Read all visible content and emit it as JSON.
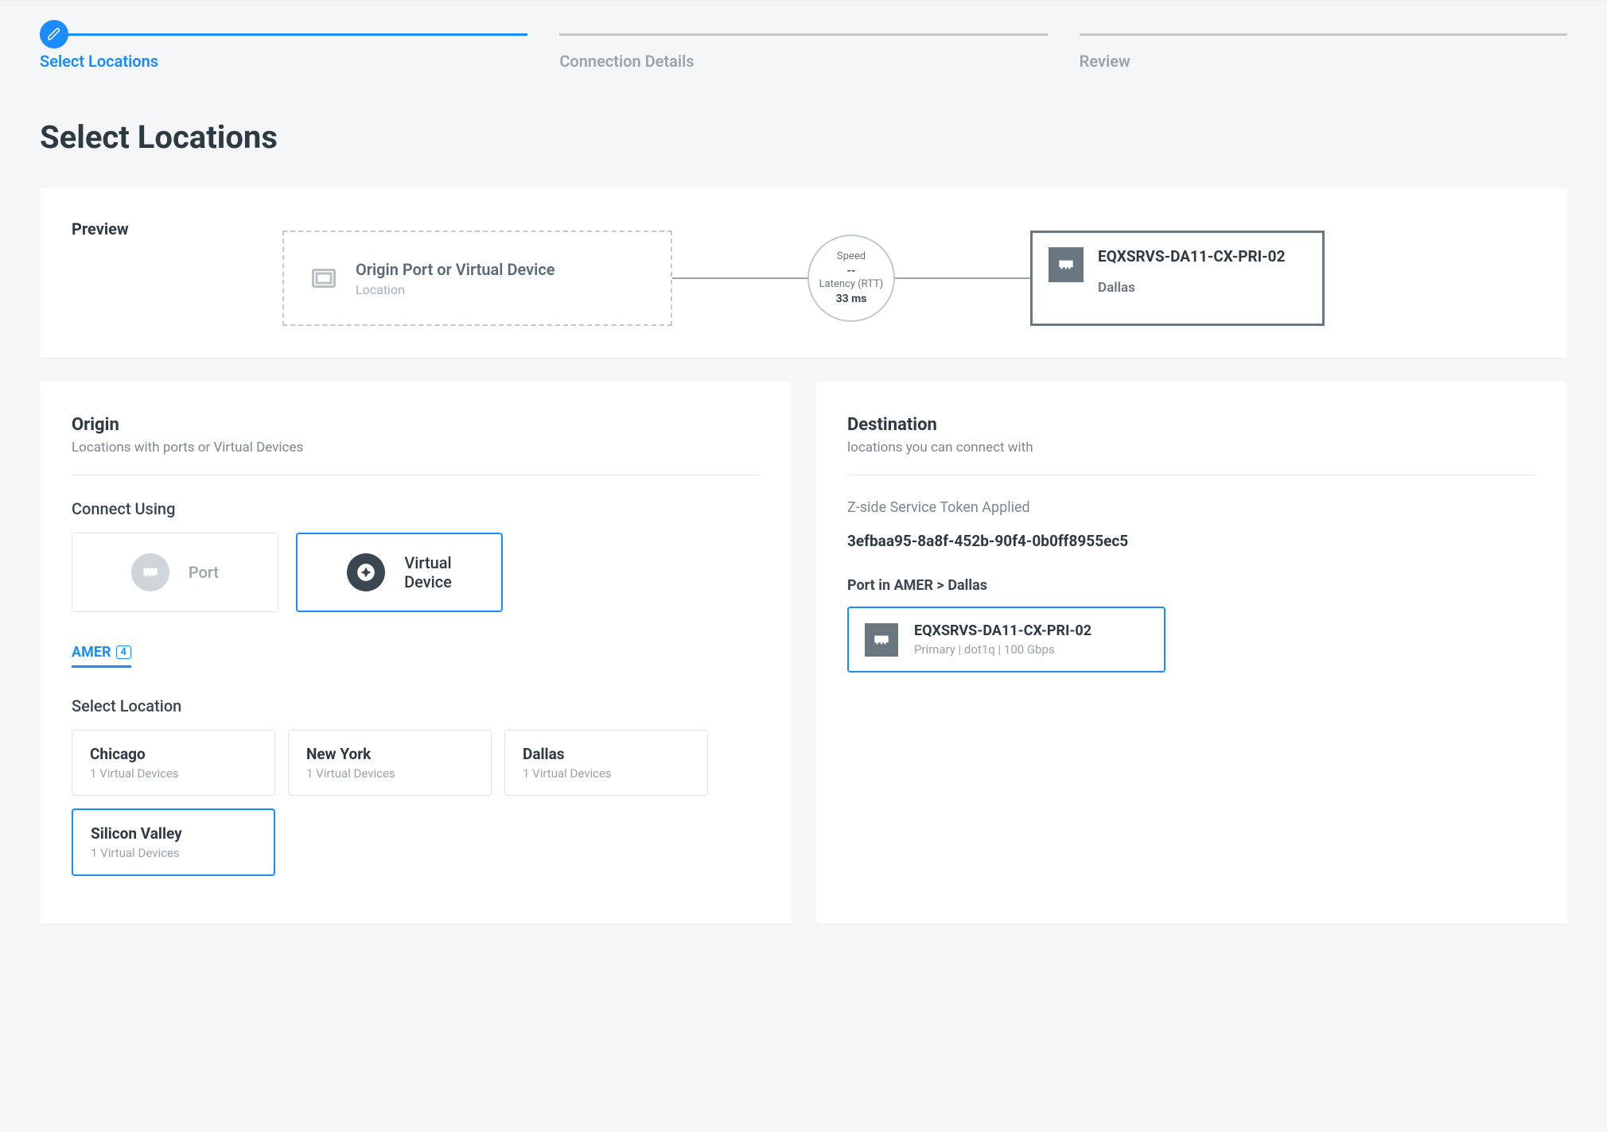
{
  "stepper": {
    "steps": [
      {
        "label": "Select Locations"
      },
      {
        "label": "Connection Details"
      },
      {
        "label": "Review"
      }
    ]
  },
  "page_title": "Select Locations",
  "preview": {
    "heading": "Preview",
    "origin_placeholder_title": "Origin Port or Virtual Device",
    "origin_placeholder_sub": "Location",
    "speed_label": "Speed",
    "speed_value": "--",
    "latency_label": "Latency (RTT)",
    "latency_value": "33 ms",
    "dest_name": "EQXSRVS-DA11-CX-PRI-02",
    "dest_location": "Dallas"
  },
  "origin": {
    "title": "Origin",
    "subtitle": "Locations with ports or Virtual Devices",
    "connect_using_label": "Connect Using",
    "options": [
      {
        "label": "Port"
      },
      {
        "label": "Virtual Device"
      }
    ],
    "region_tab": "AMER",
    "region_count": "4",
    "select_location_label": "Select Location",
    "locations": [
      {
        "name": "Chicago",
        "sub": "1 Virtual Devices"
      },
      {
        "name": "New York",
        "sub": "1 Virtual Devices"
      },
      {
        "name": "Dallas",
        "sub": "1 Virtual Devices"
      },
      {
        "name": "Silicon Valley",
        "sub": "1 Virtual Devices"
      }
    ]
  },
  "destination": {
    "title": "Destination",
    "subtitle": "locations you can connect with",
    "token_label": "Z-side Service Token Applied",
    "token_value": "3efbaa95-8a8f-452b-90f4-0b0ff8955ec5",
    "port_path": "Port in AMER > Dallas",
    "port_name": "EQXSRVS-DA11-CX-PRI-02",
    "port_sub": "Primary | dot1q | 100 Gbps"
  }
}
